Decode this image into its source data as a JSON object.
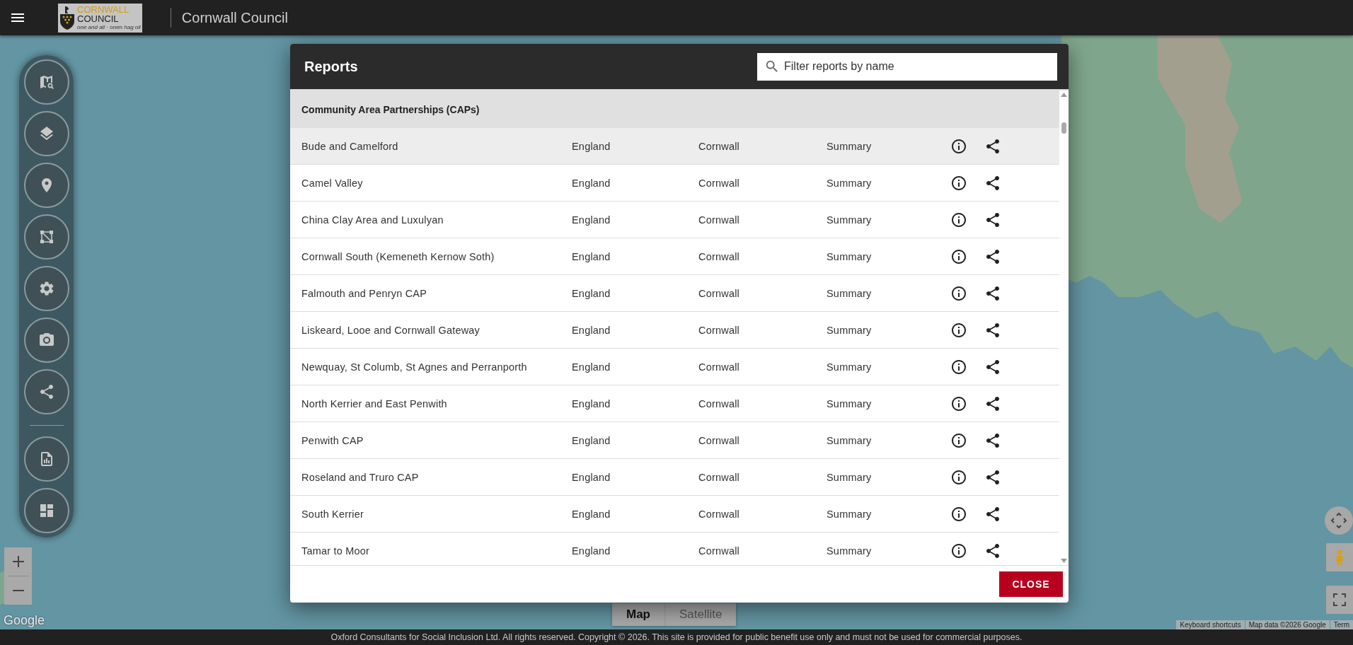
{
  "app_bar": {
    "logo": {
      "line_1": "CORNWALL",
      "line_2": "COUNCIL",
      "tagline": "one and all · onen hag oll"
    },
    "title": "Cornwall Council"
  },
  "reports_dialog": {
    "title": "Reports",
    "search": {
      "placeholder": "Filter reports by name"
    },
    "group": "Community Area Partnerships (CAPs)",
    "rows": [
      {
        "name": "Bude and Camelford",
        "column_2": "England",
        "column_3": "Cornwall",
        "column_4": "Summary",
        "highlighted": true
      },
      {
        "name": "Camel Valley",
        "column_2": "England",
        "column_3": "Cornwall",
        "column_4": "Summary",
        "highlighted": false
      },
      {
        "name": "China Clay Area and Luxulyan",
        "column_2": "England",
        "column_3": "Cornwall",
        "column_4": "Summary",
        "highlighted": false
      },
      {
        "name": "Cornwall South (Kemeneth Kernow Soth)",
        "column_2": "England",
        "column_3": "Cornwall",
        "column_4": "Summary",
        "highlighted": false
      },
      {
        "name": "Falmouth and Penryn CAP",
        "column_2": "England",
        "column_3": "Cornwall",
        "column_4": "Summary",
        "highlighted": false
      },
      {
        "name": "Liskeard, Looe and Cornwall Gateway",
        "column_2": "England",
        "column_3": "Cornwall",
        "column_4": "Summary",
        "highlighted": false
      },
      {
        "name": "Newquay, St Columb, St Agnes and Perranporth",
        "column_2": "England",
        "column_3": "Cornwall",
        "column_4": "Summary",
        "highlighted": false
      },
      {
        "name": "North Kerrier and East Penwith",
        "column_2": "England",
        "column_3": "Cornwall",
        "column_4": "Summary",
        "highlighted": false
      },
      {
        "name": "Penwith CAP",
        "column_2": "England",
        "column_3": "Cornwall",
        "column_4": "Summary",
        "highlighted": false
      },
      {
        "name": "Roseland and Truro CAP",
        "column_2": "England",
        "column_3": "Cornwall",
        "column_4": "Summary",
        "highlighted": false
      },
      {
        "name": "South Kerrier",
        "column_2": "England",
        "column_3": "Cornwall",
        "column_4": "Summary",
        "highlighted": false
      },
      {
        "name": "Tamar to Moor",
        "column_2": "England",
        "column_3": "Cornwall",
        "column_4": "Summary",
        "highlighted": false
      }
    ],
    "close_button": "CLOSE"
  },
  "map_type": [
    {
      "label": "Map",
      "selected": true
    },
    {
      "label": "Satellite",
      "selected": false
    }
  ],
  "map_logo": "Google",
  "attribution": [
    "Keyboard shortcuts",
    "Map data ©2026 Google",
    "Term"
  ],
  "footer": "Oxford Consultants for Social Inclusion Ltd. All rights reserved. Copyright © 2026. This site is provided for public benefit use only and must not be used for commercial purposes."
}
